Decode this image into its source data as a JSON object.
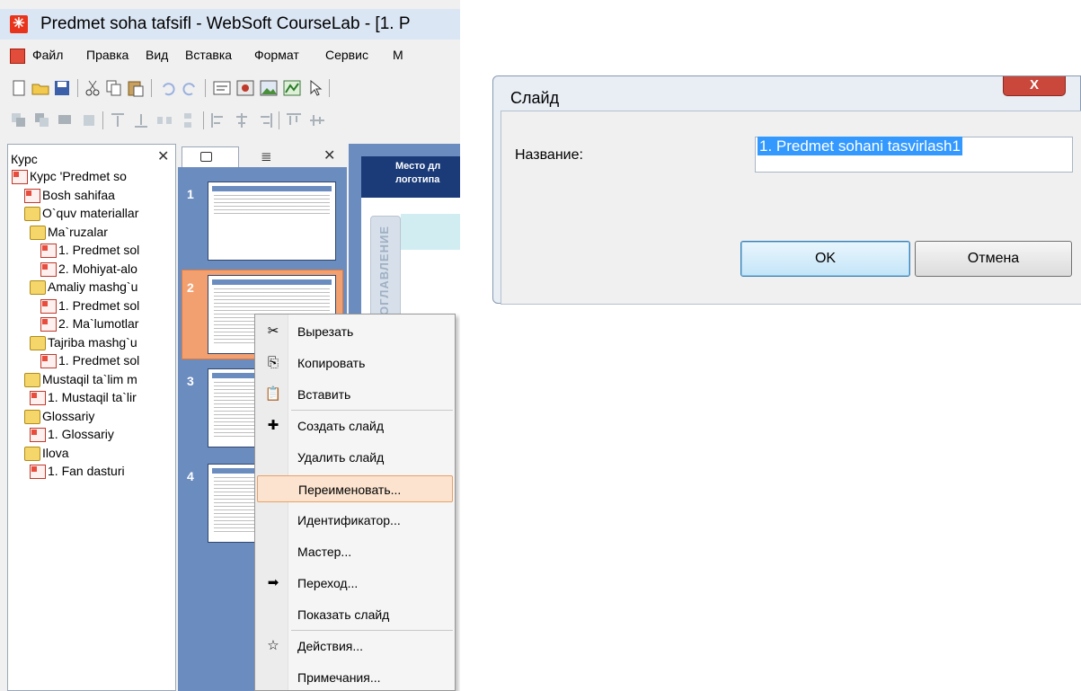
{
  "app": {
    "title": "Predmet soha tafsifl - WebSoft CourseLab - [1. P",
    "menu": [
      "Файл",
      "Правка",
      "Вид",
      "Вставка",
      "Формат",
      "Сервис",
      "М"
    ]
  },
  "course_panel": {
    "header": "Курс",
    "close": "✕",
    "items": [
      {
        "label": "Курс 'Predmet so",
        "icon": "course-icon",
        "level": 0
      },
      {
        "label": "Bosh sahifaa",
        "icon": "page-icon",
        "level": 1
      },
      {
        "label": "O`quv materiallar",
        "icon": "folder-icon",
        "level": 1
      },
      {
        "label": "Ma`ruzalar",
        "icon": "folder-icon",
        "level": 2
      },
      {
        "label": "1. Predmet sol",
        "icon": "page-icon",
        "level": 3
      },
      {
        "label": "2. Mohiyat-alo",
        "icon": "page-icon",
        "level": 3
      },
      {
        "label": "Amaliy mashg`u",
        "icon": "folder-icon",
        "level": 2
      },
      {
        "label": "1. Predmet sol",
        "icon": "page-icon",
        "level": 3
      },
      {
        "label": "2. Ma`lumotlar",
        "icon": "page-icon",
        "level": 3
      },
      {
        "label": "Tajriba mashg`u",
        "icon": "folder-icon",
        "level": 2
      },
      {
        "label": "1. Predmet sol",
        "icon": "page-icon",
        "level": 3
      },
      {
        "label": "Mustaqil ta`lim m",
        "icon": "folder-icon",
        "level": 1
      },
      {
        "label": "1. Mustaqil ta`lir",
        "icon": "page-icon",
        "level": 2
      },
      {
        "label": "Glossariy",
        "icon": "folder-icon",
        "level": 1
      },
      {
        "label": "1. Glossariy",
        "icon": "page-icon",
        "level": 2
      },
      {
        "label": "Ilova",
        "icon": "folder-icon",
        "level": 1
      },
      {
        "label": "1. Fan dasturi",
        "icon": "page-icon",
        "level": 2
      }
    ]
  },
  "slides_panel": {
    "close": "✕",
    "slides": [
      "1",
      "2",
      "3",
      "4"
    ],
    "selected_slide": "2"
  },
  "preview": {
    "logo_text": "Место дл логотипа",
    "side_tab": "ОГЛАВЛЕНИЕ"
  },
  "context_menu": {
    "items": [
      {
        "label": "Вырезать",
        "icon": "scissors-icon"
      },
      {
        "label": "Копировать",
        "icon": "copy-icon"
      },
      {
        "label": "Вставить",
        "icon": "paste-icon"
      },
      {
        "label": "Создать слайд",
        "icon": "new-slide-icon"
      },
      {
        "label": "Удалить слайд",
        "icon": ""
      },
      {
        "label": "Переименовать...",
        "icon": "",
        "highlighted": true
      },
      {
        "label": "Идентификатор...",
        "icon": ""
      },
      {
        "label": "Мастер...",
        "icon": ""
      },
      {
        "label": "Переход...",
        "icon": "transition-icon"
      },
      {
        "label": "Показать слайд",
        "icon": ""
      },
      {
        "label": "Действия...",
        "icon": "actions-icon"
      },
      {
        "label": "Примечания...",
        "icon": ""
      }
    ]
  },
  "dialog": {
    "title": "Слайд",
    "close": "X",
    "name_label": "Название:",
    "name_value": "1. Predmet sohani tasvirlash1",
    "ok_label": "OK",
    "cancel_label": "Отмена"
  },
  "colors": {
    "slides_bg": "#6b8cbf",
    "selection_orange": "#f3a071",
    "menu_highlight": "#fbe3cf",
    "dialog_close_red": "#c9483b"
  }
}
